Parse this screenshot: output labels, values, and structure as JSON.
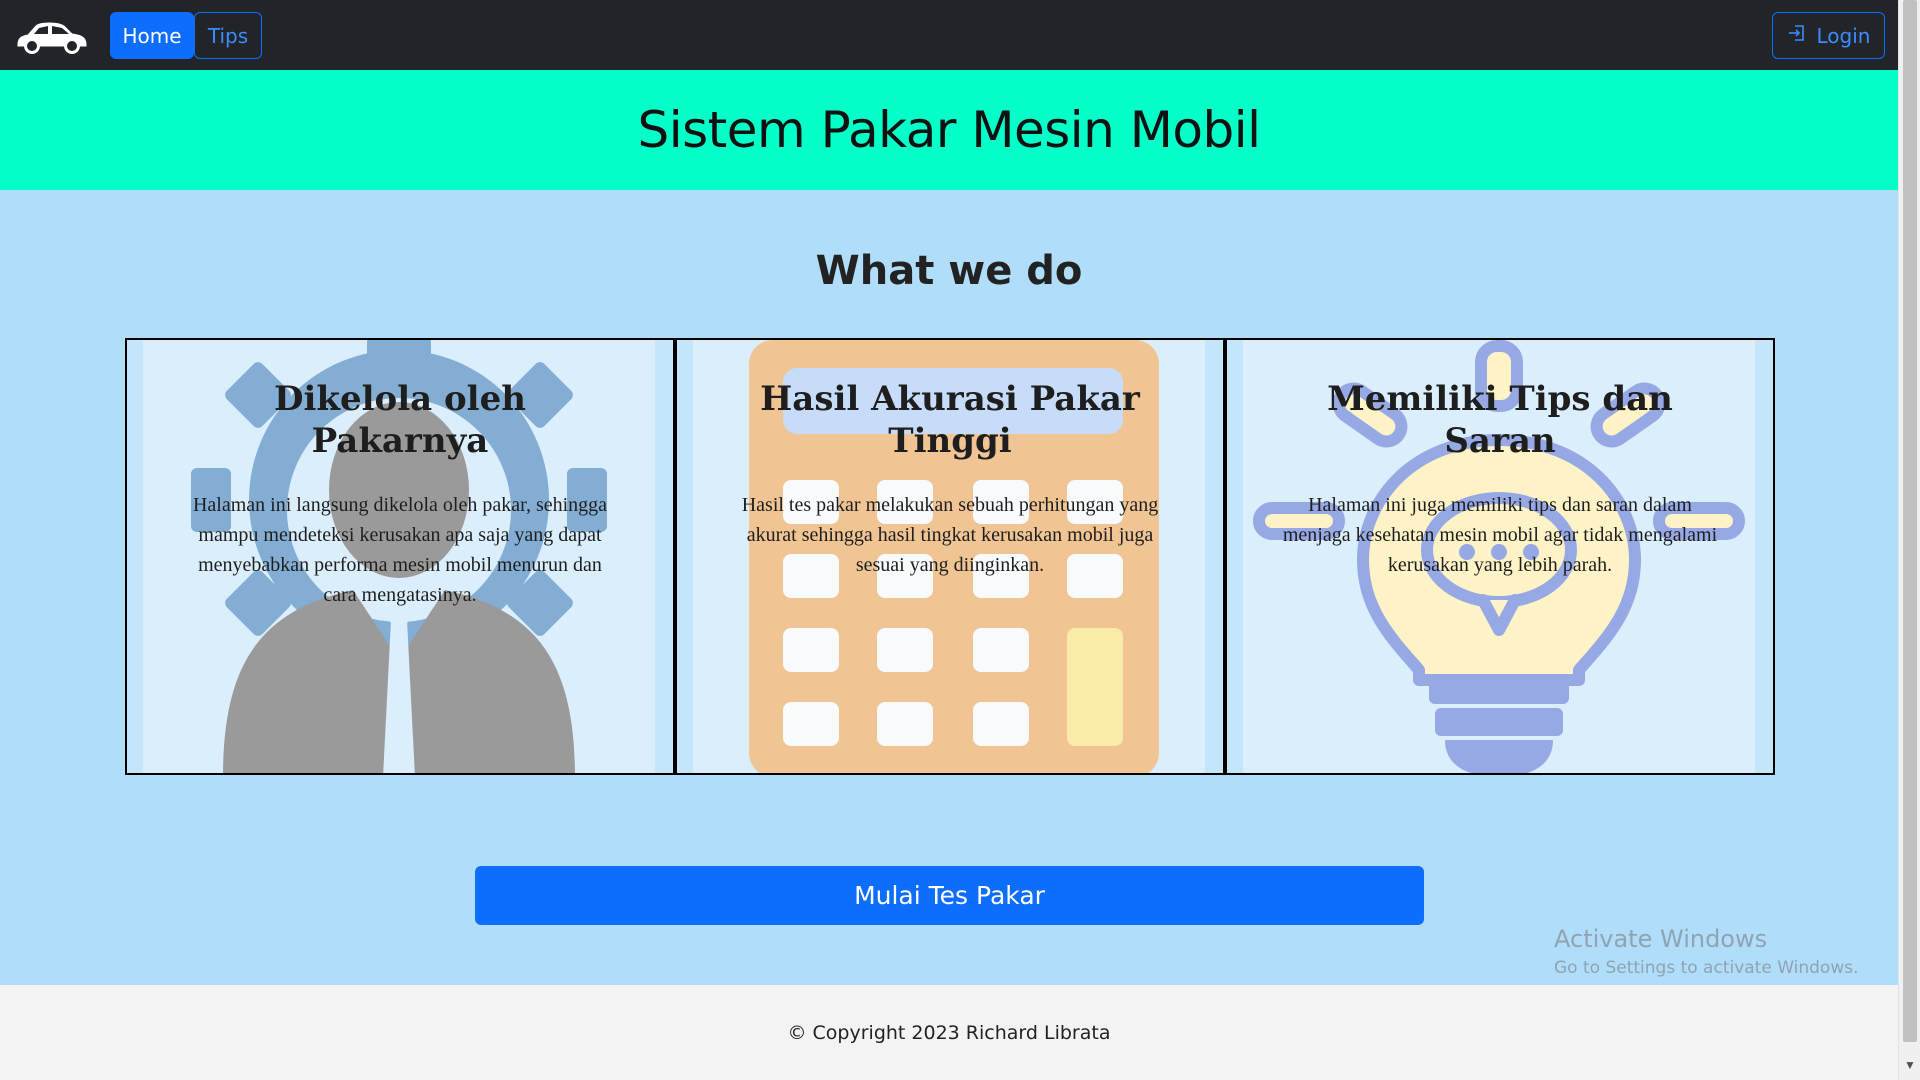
{
  "navbar": {
    "brand_icon": "car-icon",
    "home_label": "Home",
    "tips_label": "Tips",
    "login_label": "Login",
    "login_icon": "login-icon"
  },
  "hero": {
    "title": "Sistem Pakar Mesin Mobil"
  },
  "section": {
    "title": "What we do",
    "cards": [
      {
        "title": "Dikelola oleh Pakarnya",
        "text": "Halaman ini langsung dikelola oleh pakar, sehingga mampu mendeteksi kerusakan apa saja yang dapat menyebabkan performa mesin mobil menurun dan cara mengatasinya.",
        "illustration": "expert-gear-icon"
      },
      {
        "title": "Hasil Akurasi Pakar Tinggi",
        "text": "Hasil tes pakar melakukan sebuah perhitungan yang akurat sehingga hasil tingkat kerusakan mobil juga sesuai yang diinginkan.",
        "illustration": "calculator-icon"
      },
      {
        "title": "Memiliki Tips dan Saran",
        "text": "Halaman ini juga memiliki tips dan saran dalam menjaga kesehatan mesin mobil agar tidak mengalami kerusakan yang lebih parah.",
        "illustration": "lightbulb-icon"
      }
    ]
  },
  "start_button": {
    "label": "Mulai Tes Pakar"
  },
  "watermark": {
    "line1": "Activate Windows",
    "line2": "Go to Settings to activate Windows."
  },
  "footer": {
    "copyright": "© Copyright 2023 Richard Librata"
  },
  "colors": {
    "navbar_bg": "#212529",
    "primary": "#0d6efd",
    "hero_bg": "#05ffc8",
    "page_bg": "#b0defa",
    "footer_bg": "#f3f3f3"
  }
}
